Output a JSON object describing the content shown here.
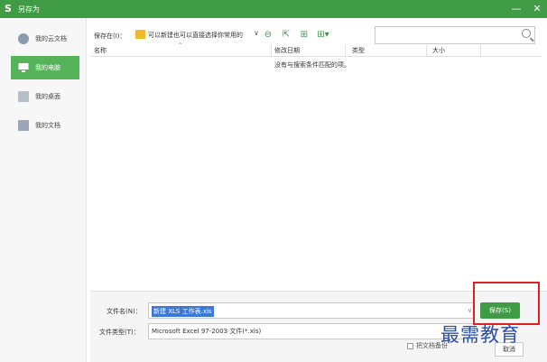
{
  "window": {
    "logo": "S",
    "title": "另存为",
    "minimize": "—",
    "close": "✕"
  },
  "sidebar": {
    "items": [
      {
        "label": "我的云文档",
        "icon": "cloud-doc-icon",
        "active": false
      },
      {
        "label": "我的电脑",
        "icon": "computer-icon",
        "active": true
      },
      {
        "label": "我的桌面",
        "icon": "desktop-icon",
        "active": false
      },
      {
        "label": "我的文档",
        "icon": "folder-icon",
        "active": false
      }
    ]
  },
  "toolbar": {
    "save_in_label": "保存在(I)：",
    "path": "可以新建也可以直接选择你常用的",
    "dropdown": "∨",
    "back": "⊖",
    "up": "⇱",
    "new_folder": "⊞",
    "view": "⊞▾"
  },
  "search": {
    "placeholder": ""
  },
  "filelist": {
    "columns": [
      "名称",
      "修改日期",
      "类型",
      "大小"
    ],
    "empty_message": "没有与搜索条件匹配的项。"
  },
  "form": {
    "filename_label": "文件名(N)：",
    "filename_value": "新建 XLS 工作表.xls",
    "filetype_label": "文件类型(T)：",
    "filetype_value": "Microsoft Excel 97-2003 文件(*.xls)",
    "save_button": "保存(S)",
    "cancel_button": "取消",
    "checkbox_label": "把文档备份"
  },
  "watermark": "最需教育",
  "colors": {
    "accent": "#3f9b44",
    "highlight": "#e02020"
  }
}
